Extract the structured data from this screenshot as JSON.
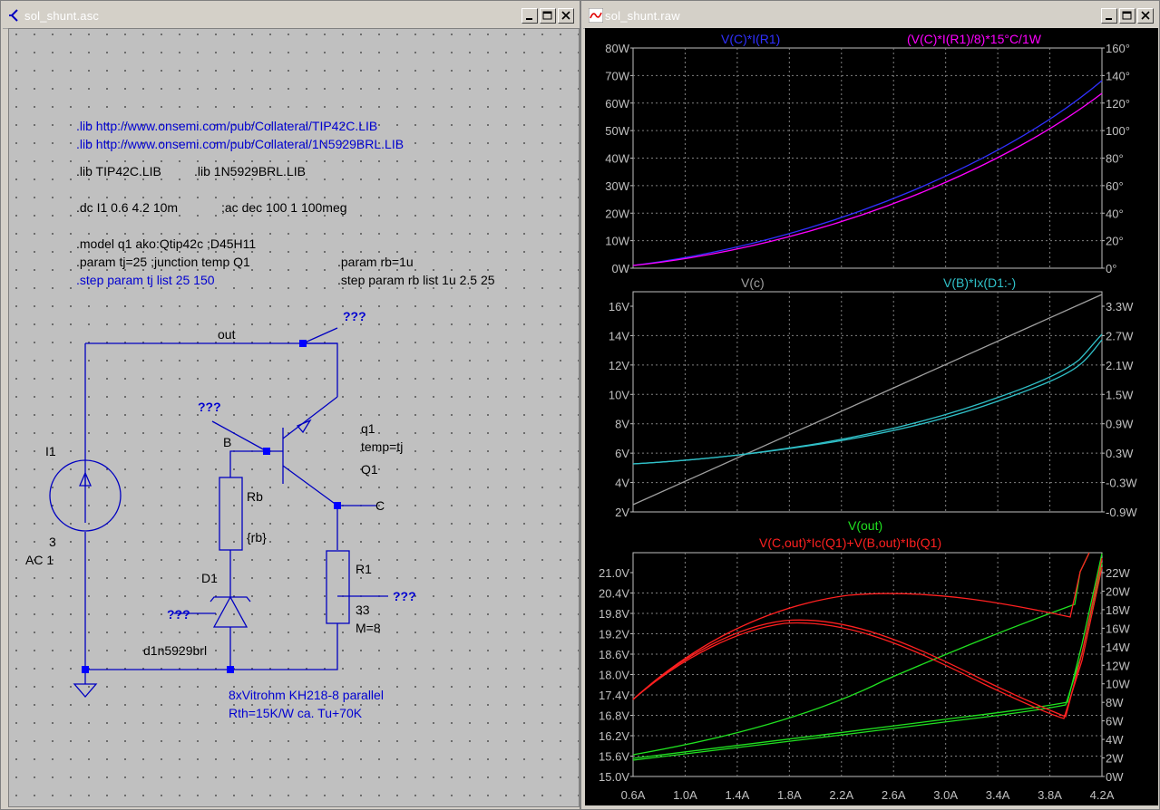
{
  "schematic_window": {
    "title": "sol_shunt.asc",
    "directives_blue": [
      ".lib http://www.onsemi.com/pub/Collateral/TIP42C.LIB",
      ".lib http://www.onsemi.com/pub/Collateral/1N5929BRL.LIB"
    ],
    "lib_local_1": ".lib TIP42C.LIB",
    "lib_local_2": ".lib 1N5929BRL.LIB",
    "dc": ".dc I1 0.6 4.2 10m",
    "ac": ";ac dec 100 1 100meg",
    "model": ".model q1 ako:Qtip42c ;D45H11",
    "param_tj": ".param tj=25 ;junction temp Q1",
    "param_rb": ".param rb=1u",
    "step_tj": ".step param tj list 25 150",
    "step_rb": ".step param rb list 1u 2.5 25",
    "labels": {
      "out": "out",
      "probe": "???",
      "i1": "I1",
      "i1_val": "3",
      "i1_ac": "AC 1",
      "b": "B",
      "c": "C",
      "q1": "q1",
      "q1_temp": "temp=tj",
      "q1_model": "Q1",
      "rb": "Rb",
      "rb_val": "{rb}",
      "d1": "D1",
      "d1_model": "d1n5929brl",
      "r1": "R1",
      "r1_val": "33",
      "r1_m": "M=8"
    },
    "note_1": "8xVitrohm KH218-8 parallel",
    "note_2": "Rth=15K/W  ca. Tu+70K"
  },
  "plot_window": {
    "title": "sol_shunt.raw",
    "pane1": {
      "trace1": "V(C)*I(R1)",
      "trace2": "(V(C)*I(R1)/8)*15°C/1W",
      "left_ticks": [
        "80W",
        "70W",
        "60W",
        "50W",
        "40W",
        "30W",
        "20W",
        "10W",
        "0W"
      ],
      "right_ticks": [
        "160°",
        "140°",
        "120°",
        "100°",
        "80°",
        "60°",
        "40°",
        "20°",
        "0°"
      ]
    },
    "pane2": {
      "trace1": "V(c)",
      "trace2": "V(B)*Ix(D1:-)",
      "left_ticks": [
        "16V",
        "14V",
        "12V",
        "10V",
        "8V",
        "6V",
        "4V",
        "2V"
      ],
      "right_ticks": [
        "3.3W",
        "2.7W",
        "2.1W",
        "1.5W",
        "0.9W",
        "0.3W",
        "-0.3W",
        "-0.9W"
      ]
    },
    "pane3": {
      "trace1": "V(out)",
      "trace2": "V(C,out)*Ic(Q1)+V(B,out)*Ib(Q1)",
      "left_ticks": [
        "21.0V",
        "20.4V",
        "19.8V",
        "19.2V",
        "18.6V",
        "18.0V",
        "17.4V",
        "16.8V",
        "16.2V",
        "15.6V",
        "15.0V"
      ],
      "right_ticks": [
        "22W",
        "20W",
        "18W",
        "16W",
        "14W",
        "12W",
        "10W",
        "8W",
        "6W",
        "4W",
        "2W",
        "0W"
      ]
    },
    "x_ticks": [
      "0.6A",
      "1.0A",
      "1.4A",
      "1.8A",
      "2.2A",
      "2.6A",
      "3.0A",
      "3.4A",
      "3.8A",
      "4.2A"
    ],
    "colors": {
      "blue": "#3030ff",
      "magenta": "#ff00ff",
      "gray": "#a0a0a0",
      "cyan": "#30c0c8",
      "green": "#20e020",
      "red": "#ff2020",
      "grid": "#808080"
    }
  }
}
